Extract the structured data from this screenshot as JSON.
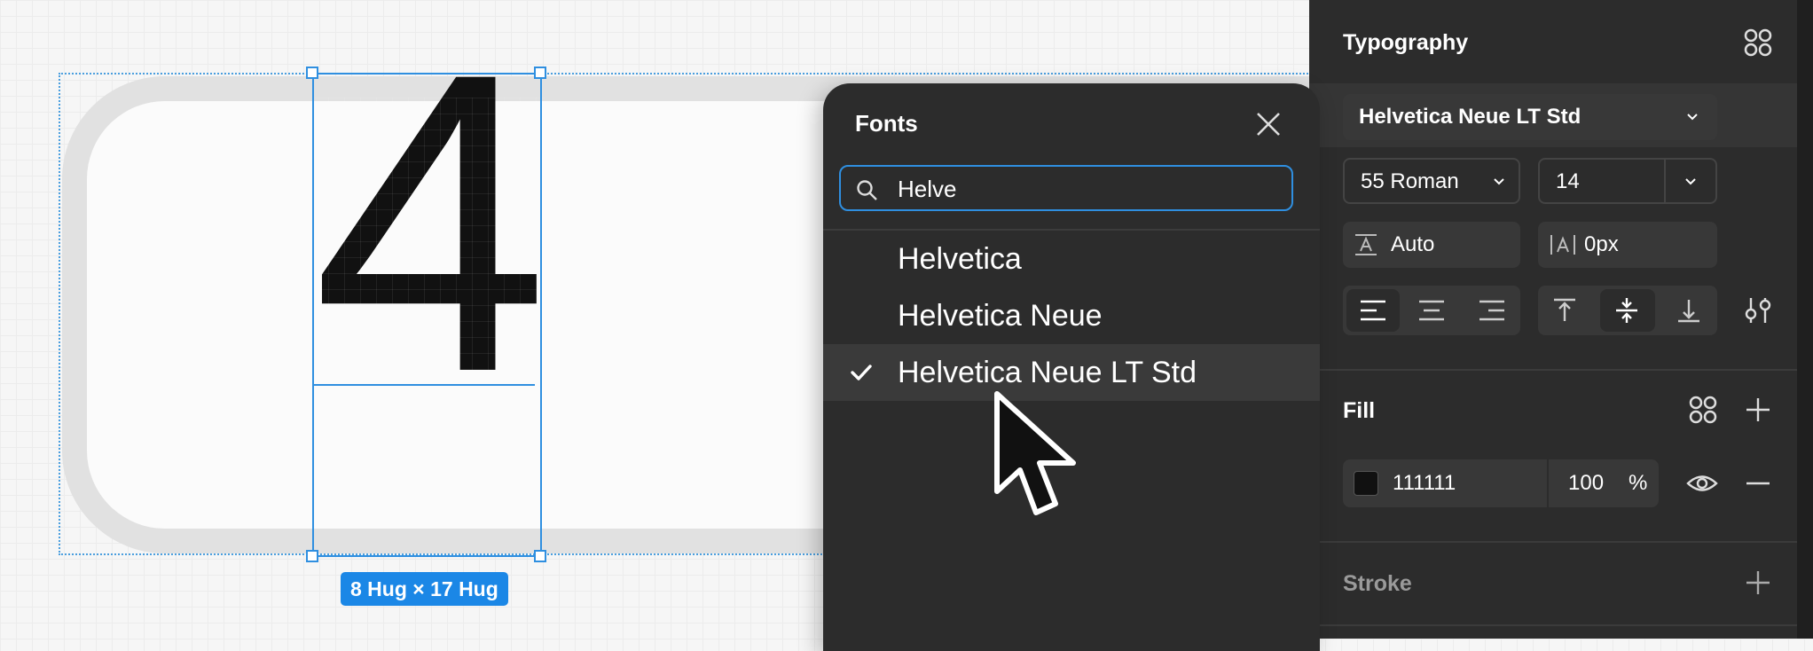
{
  "canvas": {
    "glyph": "4",
    "size_label": "8 Hug × 17 Hug"
  },
  "fonts_popover": {
    "title": "Fonts",
    "search_value": "Helve",
    "results": [
      {
        "name": "Helvetica",
        "selected": false
      },
      {
        "name": "Helvetica Neue",
        "selected": false
      },
      {
        "name": "Helvetica Neue LT Std",
        "selected": true
      }
    ]
  },
  "typography": {
    "title": "Typography",
    "font_family": "Helvetica Neue LT Std",
    "font_weight": "55 Roman",
    "font_size": "14",
    "line_height": "Auto",
    "letter_spacing": "0px"
  },
  "fill": {
    "title": "Fill",
    "hex": "111111",
    "opacity": "100",
    "opacity_unit": "%",
    "swatch_color": "#111111"
  },
  "stroke": {
    "title": "Stroke"
  },
  "colors": {
    "accent": "#1b87e6",
    "panel_bg": "#2c2c2c"
  }
}
